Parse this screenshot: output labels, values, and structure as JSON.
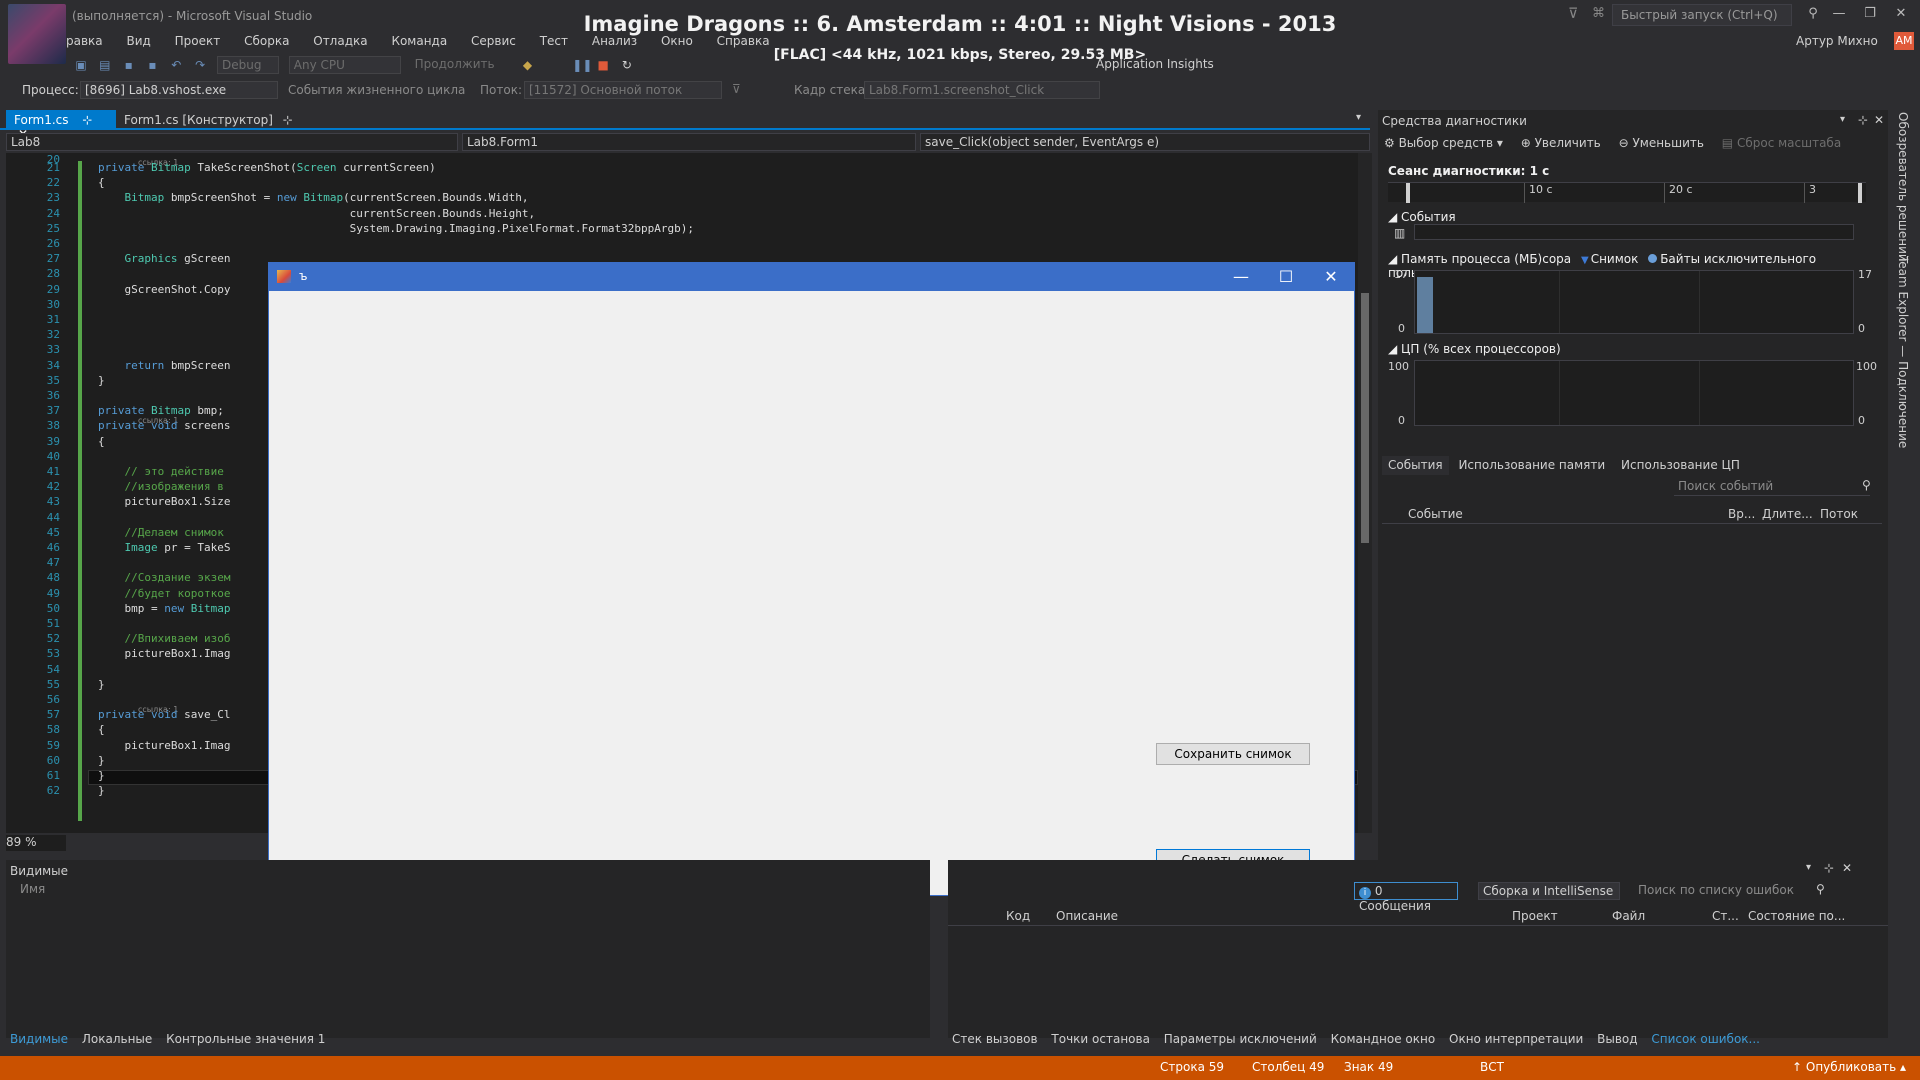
{
  "title": {
    "window": "(выполняется) - Microsoft Visual Studio",
    "now_playing": "Imagine Dragons :: 6. Amsterdam :: 4:01 :: Night Visions - 2013",
    "now_playing_sub": "[FLAC] <44 kHz, 1021 kbps, Stereo, 29.53 MB>",
    "quick_launch_placeholder": "Быстрый запуск (Ctrl+Q)",
    "user": "Артур Михно",
    "user_initials": "АМ"
  },
  "menu": [
    "равка",
    "Вид",
    "Проект",
    "Сборка",
    "Отладка",
    "Команда",
    "Сервис",
    "Тест",
    "Анализ",
    "Окно",
    "Справка"
  ],
  "toolbar": {
    "config": "Debug",
    "platform": "Any CPU",
    "continue": "Продолжить",
    "insights": "Application Insights"
  },
  "debugbar": {
    "process_label": "Процесс:",
    "process": "[8696] Lab8.vshost.exe",
    "lifecycle": "События жизненного цикла",
    "thread_label": "Поток:",
    "thread": "[11572] Основной поток",
    "stack_label": "Кадр стека:",
    "stack": "Lab8.Form1.screenshot_Click"
  },
  "tabs": {
    "file": "Form1.cs",
    "designer": "Form1.cs [Конструктор]"
  },
  "nav": {
    "project": "Lab8",
    "class": "Lab8.Form1",
    "member": "save_Click(object sender, EventArgs e)"
  },
  "code": {
    "ref_note": "ссылка: 1",
    "lines": [
      {
        "n": "20",
        "t": ""
      },
      {
        "n": "21",
        "t": "private Bitmap TakeScreenShot(Screen currentScreen)"
      },
      {
        "n": "22",
        "t": "{"
      },
      {
        "n": "23",
        "t": "    Bitmap bmpScreenShot = new Bitmap(currentScreen.Bounds.Width,"
      },
      {
        "n": "24",
        "t": "                                      currentScreen.Bounds.Height,"
      },
      {
        "n": "25",
        "t": "                                      System.Drawing.Imaging.PixelFormat.Format32bppArgb);"
      },
      {
        "n": "26",
        "t": ""
      },
      {
        "n": "27",
        "t": "    Graphics gScreen"
      },
      {
        "n": "28",
        "t": ""
      },
      {
        "n": "29",
        "t": "    gScreenShot.Copy"
      },
      {
        "n": "30",
        "t": ""
      },
      {
        "n": "31",
        "t": ""
      },
      {
        "n": "32",
        "t": ""
      },
      {
        "n": "33",
        "t": ""
      },
      {
        "n": "34",
        "t": "    return bmpScreen"
      },
      {
        "n": "35",
        "t": "}"
      },
      {
        "n": "36",
        "t": ""
      },
      {
        "n": "37",
        "t": "private Bitmap bmp;"
      },
      {
        "n": "38",
        "t": "private void screens"
      },
      {
        "n": "39",
        "t": "{"
      },
      {
        "n": "40",
        "t": ""
      },
      {
        "n": "41",
        "t": "    // это действие"
      },
      {
        "n": "42",
        "t": "    //изображения в"
      },
      {
        "n": "43",
        "t": "    pictureBox1.Size"
      },
      {
        "n": "44",
        "t": ""
      },
      {
        "n": "45",
        "t": "    //Делаем снимок"
      },
      {
        "n": "46",
        "t": "    Image pr = TakeS"
      },
      {
        "n": "47",
        "t": ""
      },
      {
        "n": "48",
        "t": "    //Создание экзем"
      },
      {
        "n": "49",
        "t": "    //будет короткое"
      },
      {
        "n": "50",
        "t": "    bmp = new Bitmap"
      },
      {
        "n": "51",
        "t": ""
      },
      {
        "n": "52",
        "t": "    //Впихиваем изоб"
      },
      {
        "n": "53",
        "t": "    pictureBox1.Imag"
      },
      {
        "n": "54",
        "t": ""
      },
      {
        "n": "55",
        "t": "}"
      },
      {
        "n": "56",
        "t": ""
      },
      {
        "n": "57",
        "t": "private void save_Cl"
      },
      {
        "n": "58",
        "t": "{"
      },
      {
        "n": "59",
        "t": "    pictureBox1.Imag"
      },
      {
        "n": "60",
        "t": "}"
      },
      {
        "n": "61",
        "t": "}"
      },
      {
        "n": "62",
        "t": "}"
      }
    ],
    "zoom": "89 %"
  },
  "winform": {
    "caption": "ъ",
    "btn_save": "Сохранить снимок",
    "btn_capture": "Сделать снимок"
  },
  "diag": {
    "title": "Средства диагностики",
    "tools": "Выбор средств",
    "zoom_in": "Увеличить",
    "zoom_out": "Уменьшить",
    "reset_zoom": "Сброс масштаба",
    "session": "Сеанс диагностики: 1 с",
    "ticks": [
      "10 с",
      "20 с",
      "3"
    ],
    "events_title": "События",
    "memory_title": "Память процесса (МБ)сора",
    "memory_legend_snapshot": "Снимок",
    "memory_legend_private": "Байты исключительного пользования",
    "memory_max": "17",
    "memory_min": "0",
    "memory_level": 0.9,
    "cpu_title": "ЦП (% всех процессоров)",
    "cpu_max": "100",
    "cpu_min": "0",
    "subtabs": [
      "События",
      "Использование памяти",
      "Использование ЦП"
    ],
    "search_placeholder": "Поиск событий",
    "columns": [
      "Событие",
      "Вр...",
      "Длите...",
      "Поток"
    ]
  },
  "right_tabs": [
    "Обозреватель решений",
    "Team Explorer — Подключение"
  ],
  "locals": {
    "title": "Видимые",
    "column": "Имя"
  },
  "errors": {
    "messages": "0 Сообщения",
    "build": "Сборка и IntelliSense",
    "search_placeholder": "Поиск по списку ошибок",
    "columns": [
      "Код",
      "Описание",
      "Проект",
      "Файл",
      "Ст...",
      "Состояние по..."
    ]
  },
  "bottom_tabs_left": [
    "Видимые",
    "Локальные",
    "Контрольные значения 1"
  ],
  "bottom_tabs_right": [
    "Стек вызовов",
    "Точки останова",
    "Параметры исключений",
    "Командное окно",
    "Окно интерпретации",
    "Вывод",
    "Список ошибок..."
  ],
  "status": {
    "line": "Строка 59",
    "col": "Столбец 49",
    "ch": "Знак 49",
    "mode": "ВСТ",
    "publish": "Опубликовать"
  }
}
